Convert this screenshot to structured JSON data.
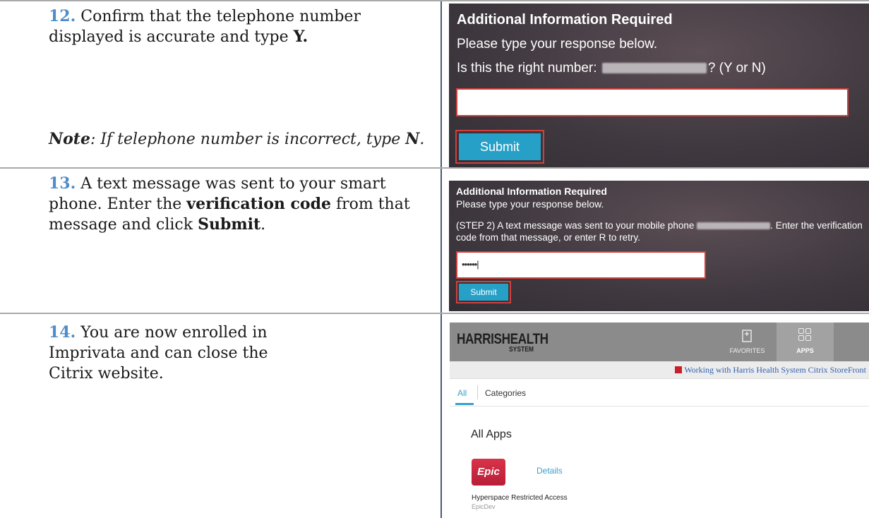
{
  "step12": {
    "number": "12.",
    "text_before": " Confirm that the telephone number displayed is accurate and type ",
    "text_bold": "Y.",
    "note_label": "Note",
    "note_text": ": If telephone number is incorrect, type ",
    "note_bold": "N",
    "note_end": ".",
    "panel": {
      "title": "Additional Information Required",
      "subtitle": "Please type your response below.",
      "question_prefix": "Is this the right number:",
      "question_suffix": "? (Y or N)",
      "input_value": "",
      "submit_label": "Submit"
    }
  },
  "step13": {
    "number": "13.",
    "t1": " A text message was sent to your smart phone. Enter the ",
    "b1": "verification code",
    "t2": " from that message and click ",
    "b2": "Submit",
    "t3": ".",
    "panel": {
      "title": "Additional Information Required",
      "subtitle": "Please type your response below.",
      "message_prefix": "(STEP 2) A text message was sent to your mobile phone",
      "message_suffix": ". Enter the verification code from that message, or enter R to retry.",
      "input_value": "••••••|",
      "submit_label": "Submit"
    }
  },
  "step14": {
    "number": "14.",
    "text": " You are now enrolled in Imprivata and can close the Citrix website.",
    "storefront": {
      "logo_main": "HARRIS",
      "logo_bold": "HEALTH",
      "logo_sub": "SYSTEM",
      "favorites_label": "FAVORITES",
      "apps_label": "APPS",
      "pdf_link": "Working with Harris Health System Citrix StoreFront",
      "tab_all": "All",
      "tab_categories": "Categories",
      "section_title": "All Apps",
      "app_logo": "Epic",
      "details_label": "Details",
      "app_name": "Hyperspace Restricted Access",
      "app_sub": "EpicDev"
    }
  },
  "colors": {
    "accent_blue": "#4f8cc9",
    "button": "#27a0c8",
    "highlight_red": "#d0403c"
  }
}
